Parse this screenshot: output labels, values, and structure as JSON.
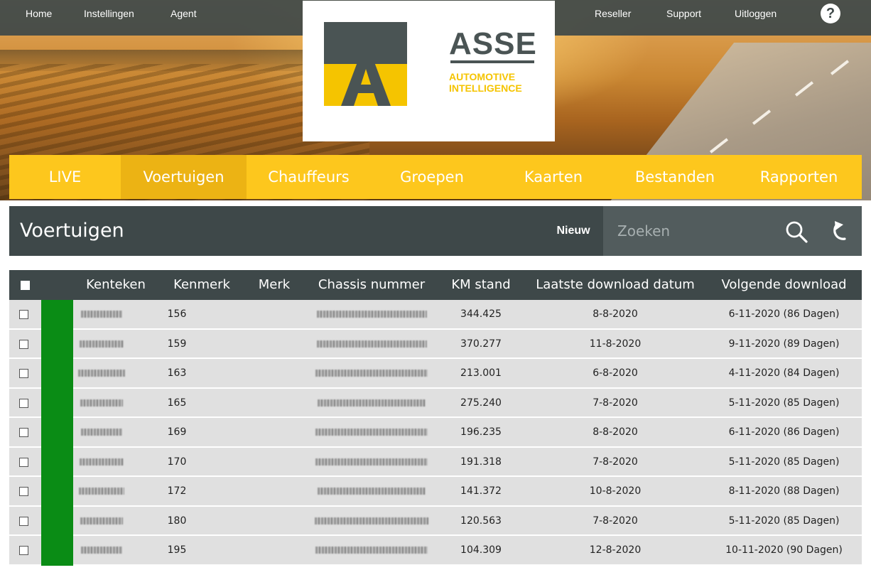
{
  "topnav": {
    "left": [
      {
        "name": "nav-home",
        "label": "Home"
      },
      {
        "name": "nav-instellingen",
        "label": "Instellingen"
      },
      {
        "name": "nav-agent",
        "label": "Agent"
      }
    ],
    "right": [
      {
        "name": "nav-reseller",
        "label": "Reseller"
      },
      {
        "name": "nav-support",
        "label": "Support"
      },
      {
        "name": "nav-uitloggen",
        "label": "Uitloggen"
      }
    ],
    "help_icon": "question-circle-icon",
    "help_glyph": "?"
  },
  "logo": {
    "letter": "A",
    "word": "ASSE",
    "tagline": "AUTOMOTIVE\nINTELLIGENCE",
    "colors": {
      "dark": "#4a5454",
      "yellow": "#f5c400"
    }
  },
  "mainnav": {
    "items": [
      {
        "label": "LIVE",
        "active": false
      },
      {
        "label": "Voertuigen",
        "active": true
      },
      {
        "label": "Chauffeurs",
        "active": false
      },
      {
        "label": "Groepen",
        "active": false
      },
      {
        "label": "Kaarten",
        "active": false
      },
      {
        "label": "Bestanden",
        "active": false
      },
      {
        "label": "Rapporten",
        "active": false
      }
    ],
    "accent": "#fdc71d",
    "active_bg": "#ecb314"
  },
  "page": {
    "title": "Voertuigen",
    "new_label": "Nieuw",
    "search_placeholder": "Zoeken",
    "search_value": "",
    "search_icon": "search-icon",
    "refresh_icon": "refresh-icon"
  },
  "table": {
    "columns": [
      "Kenteken",
      "Kenmerk",
      "Merk",
      "Chassis nummer",
      "KM stand",
      "Laatste download datum",
      "Volgende download"
    ],
    "status_color": "#0a8c15",
    "rows": [
      {
        "kenmerk": "156",
        "merk": "",
        "km": "344.425",
        "last": "8-8-2020",
        "next": "6-11-2020 (86 Dagen)"
      },
      {
        "kenmerk": "159",
        "merk": "",
        "km": "370.277",
        "last": "11-8-2020",
        "next": "9-11-2020 (89 Dagen)"
      },
      {
        "kenmerk": "163",
        "merk": "",
        "km": "213.001",
        "last": "6-8-2020",
        "next": "4-11-2020 (84 Dagen)"
      },
      {
        "kenmerk": "165",
        "merk": "",
        "km": "275.240",
        "last": "7-8-2020",
        "next": "5-11-2020 (85 Dagen)"
      },
      {
        "kenmerk": "169",
        "merk": "",
        "km": "196.235",
        "last": "8-8-2020",
        "next": "6-11-2020 (86 Dagen)"
      },
      {
        "kenmerk": "170",
        "merk": "",
        "km": "191.318",
        "last": "7-8-2020",
        "next": "5-11-2020 (85 Dagen)"
      },
      {
        "kenmerk": "172",
        "merk": "",
        "km": "141.372",
        "last": "10-8-2020",
        "next": "8-11-2020 (88 Dagen)"
      },
      {
        "kenmerk": "180",
        "merk": "",
        "km": "120.563",
        "last": "7-8-2020",
        "next": "5-11-2020 (85 Dagen)"
      },
      {
        "kenmerk": "195",
        "merk": "",
        "km": "104.309",
        "last": "12-8-2020",
        "next": "10-11-2020 (90 Dagen)"
      }
    ]
  }
}
